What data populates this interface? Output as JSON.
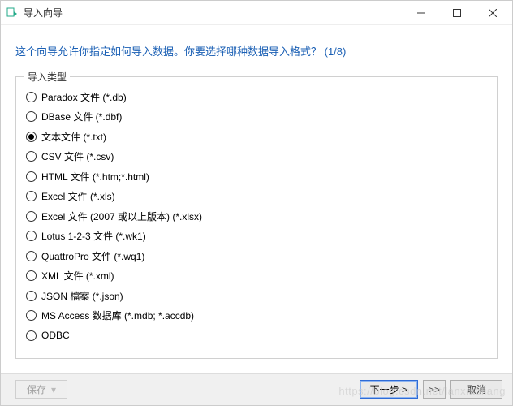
{
  "window": {
    "title": "导入向导"
  },
  "heading": "这个向导允许你指定如何导入数据。你要选择哪种数据导入格式？ (1/8)",
  "fieldset": {
    "legend": "导入类型",
    "selected_index": 2,
    "options": [
      "Paradox 文件 (*.db)",
      "DBase 文件 (*.dbf)",
      "文本文件 (*.txt)",
      "CSV 文件 (*.csv)",
      "HTML 文件 (*.htm;*.html)",
      "Excel 文件 (*.xls)",
      "Excel 文件 (2007 或以上版本) (*.xlsx)",
      "Lotus 1-2-3 文件 (*.wk1)",
      "QuattroPro 文件 (*.wq1)",
      "XML 文件 (*.xml)",
      "JSON 檔案 (*.json)",
      "MS Access 数据库 (*.mdb; *.accdb)",
      "ODBC"
    ]
  },
  "footer": {
    "save": "保存",
    "next": "下一步 >",
    "skip": ">>",
    "cancel": "取消"
  },
  "watermark": "https://blog.csdn.net/lanxiaoliang"
}
